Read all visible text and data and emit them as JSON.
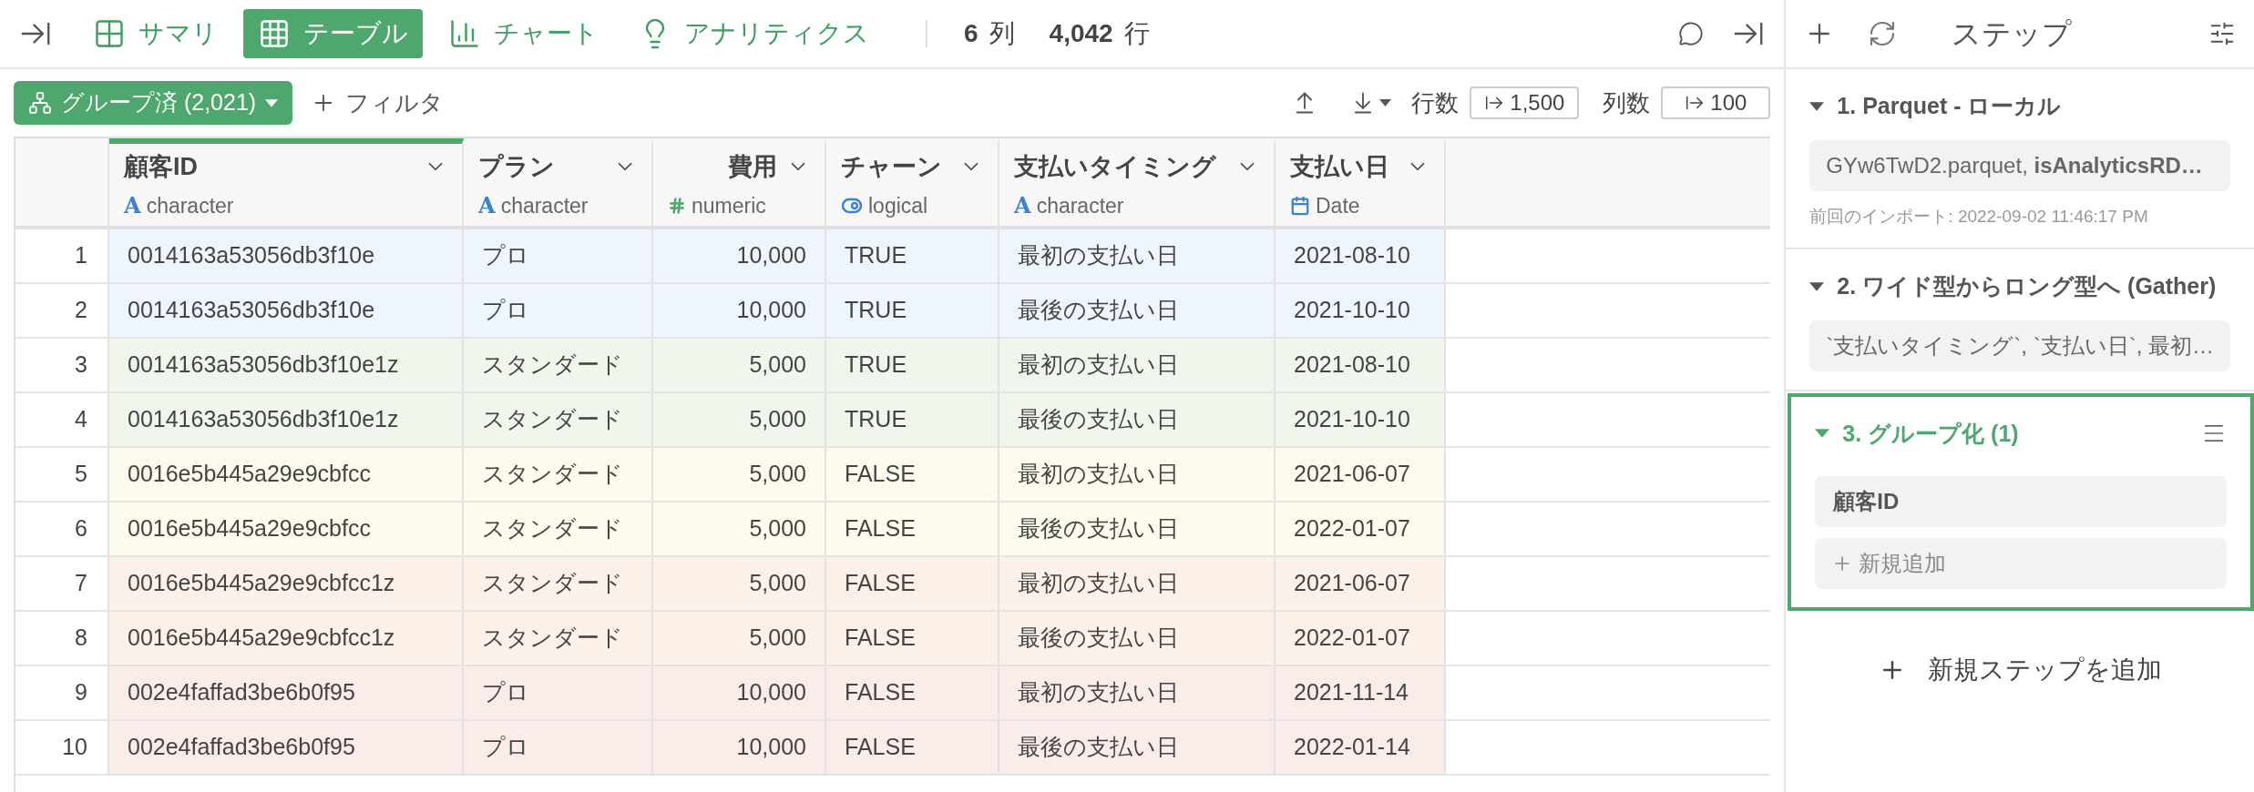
{
  "view_tabs": [
    {
      "label": "サマリ",
      "kind": "summary",
      "selected": false
    },
    {
      "label": "テーブル",
      "kind": "table",
      "selected": true
    },
    {
      "label": "チャート",
      "kind": "chart",
      "selected": false
    },
    {
      "label": "アナリティクス",
      "kind": "analytics",
      "selected": false
    }
  ],
  "counts": [
    {
      "value": "6",
      "unit": "列"
    },
    {
      "value": "4,042",
      "unit": "行"
    }
  ],
  "toolbar": {
    "group_button": "グループ済 (2,021)",
    "filter_button": "フィルタ",
    "rows_label": "行数",
    "rows_value": "1,500",
    "cols_label": "列数",
    "cols_value": "100"
  },
  "table": {
    "columns": [
      {
        "name": "顧客ID",
        "type": "character",
        "kind": "character",
        "type_icon": "A",
        "grouped": true
      },
      {
        "name": "プラン",
        "type": "character",
        "kind": "character",
        "type_icon": "A",
        "grouped": false
      },
      {
        "name": "費用",
        "type": "numeric",
        "kind": "numeric",
        "grouped": false
      },
      {
        "name": "チャーン",
        "type": "logical",
        "kind": "logical",
        "grouped": false
      },
      {
        "name": "支払いタイミング",
        "type": "character",
        "kind": "character",
        "type_icon": "A",
        "grouped": false
      },
      {
        "name": "支払い日",
        "type": "Date",
        "kind": "date",
        "grouped": false
      }
    ],
    "rows": [
      {
        "number": "1",
        "color": "#eef5fc",
        "cells": [
          "0014163a53056db3f10e",
          "プロ",
          "10,000",
          "TRUE",
          "最初の支払い日",
          "2021-08-10"
        ]
      },
      {
        "number": "2",
        "color": "#eef5fc",
        "cells": [
          "0014163a53056db3f10e",
          "プロ",
          "10,000",
          "TRUE",
          "最後の支払い日",
          "2021-10-10"
        ]
      },
      {
        "number": "3",
        "color": "#f0f6ec",
        "cells": [
          "0014163a53056db3f10e1z",
          "スタンダード",
          "5,000",
          "TRUE",
          "最初の支払い日",
          "2021-08-10"
        ]
      },
      {
        "number": "4",
        "color": "#f0f6ec",
        "cells": [
          "0014163a53056db3f10e1z",
          "スタンダード",
          "5,000",
          "TRUE",
          "最後の支払い日",
          "2021-10-10"
        ]
      },
      {
        "number": "5",
        "color": "#fcfbee",
        "cells": [
          "0016e5b445a29e9cbfcc",
          "スタンダード",
          "5,000",
          "FALSE",
          "最初の支払い日",
          "2021-06-07"
        ]
      },
      {
        "number": "6",
        "color": "#fcfbee",
        "cells": [
          "0016e5b445a29e9cbfcc",
          "スタンダード",
          "5,000",
          "FALSE",
          "最後の支払い日",
          "2022-01-07"
        ]
      },
      {
        "number": "7",
        "color": "#fbf1e9",
        "cells": [
          "0016e5b445a29e9cbfcc1z",
          "スタンダード",
          "5,000",
          "FALSE",
          "最初の支払い日",
          "2021-06-07"
        ]
      },
      {
        "number": "8",
        "color": "#fbf1e9",
        "cells": [
          "0016e5b445a29e9cbfcc1z",
          "スタンダード",
          "5,000",
          "FALSE",
          "最後の支払い日",
          "2022-01-07"
        ]
      },
      {
        "number": "9",
        "color": "#f9ece9",
        "cells": [
          "002e4faffad3be6b0f95",
          "プロ",
          "10,000",
          "FALSE",
          "最初の支払い日",
          "2021-11-14"
        ]
      },
      {
        "number": "10",
        "color": "#f9ece9",
        "cells": [
          "002e4faffad3be6b0f95",
          "プロ",
          "10,000",
          "FALSE",
          "最後の支払い日",
          "2022-01-14"
        ]
      }
    ]
  },
  "steps_panel": {
    "title": "ステップ",
    "steps": [
      {
        "title": "1. Parquet - ローカル",
        "expanded": true,
        "selected": false,
        "summary": "GYw6TwD2.parquet, **isAnalyticsRD…**",
        "note": "前回のインポート: 2022-09-02 11:46:17 PM"
      },
      {
        "title": "2. ワイド型からロング型へ (Gather)",
        "expanded": true,
        "selected": false,
        "summary": "`支払いタイミング`, `支払い日`, 最初…"
      },
      {
        "title": "3. グループ化 (1)",
        "expanded": true,
        "selected": true,
        "items": [
          "顧客ID"
        ],
        "add_label": "新規追加"
      }
    ],
    "add_step": "新規ステップを追加"
  }
}
